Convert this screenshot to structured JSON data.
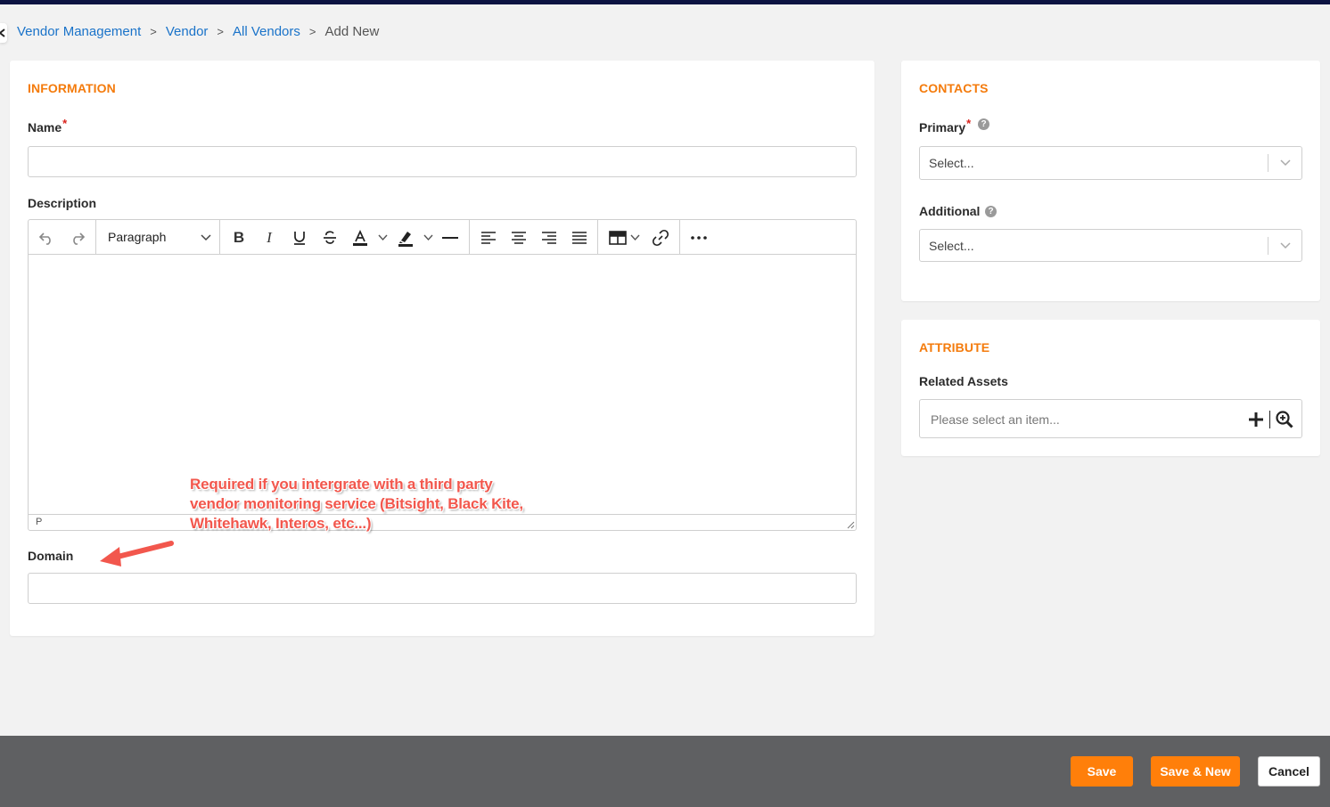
{
  "breadcrumb": {
    "items": [
      "Vendor Management",
      "Vendor",
      "All Vendors"
    ],
    "separator": ">",
    "current": "Add New"
  },
  "information": {
    "title": "INFORMATION",
    "name_label": "Name",
    "required_mark": "*",
    "description_label": "Description",
    "editor": {
      "block_format": "Paragraph",
      "status_path": "P",
      "toolbar_icons": [
        "undo-icon",
        "redo-icon",
        "bold-icon",
        "italic-icon",
        "underline-icon",
        "strikethrough-icon",
        "text-color-icon",
        "highlight-icon",
        "horizontal-rule-icon",
        "align-left-icon",
        "align-center-icon",
        "align-right-icon",
        "justify-icon",
        "table-icon",
        "link-icon",
        "more-icon"
      ]
    },
    "domain_label": "Domain"
  },
  "annotation": {
    "text": "Required if you intergrate with a third party vendor monitoring service (Bitsight, Black Kite, Whitehawk, Interos, etc...)",
    "color": "#f2574d"
  },
  "contacts": {
    "title": "CONTACTS",
    "primary_label": "Primary",
    "additional_label": "Additional",
    "select_placeholder": "Select..."
  },
  "attribute": {
    "title": "ATTRIBUTE",
    "related_assets_label": "Related Assets",
    "related_assets_placeholder": "Please select an item..."
  },
  "footer": {
    "save": "Save",
    "save_new": "Save & New",
    "cancel": "Cancel"
  },
  "colors": {
    "accent": "#f47b0c",
    "link": "#1a73c9",
    "button_orange": "#ff7f0a",
    "footer_bg": "#5f6062",
    "topbar": "#0d1442"
  }
}
